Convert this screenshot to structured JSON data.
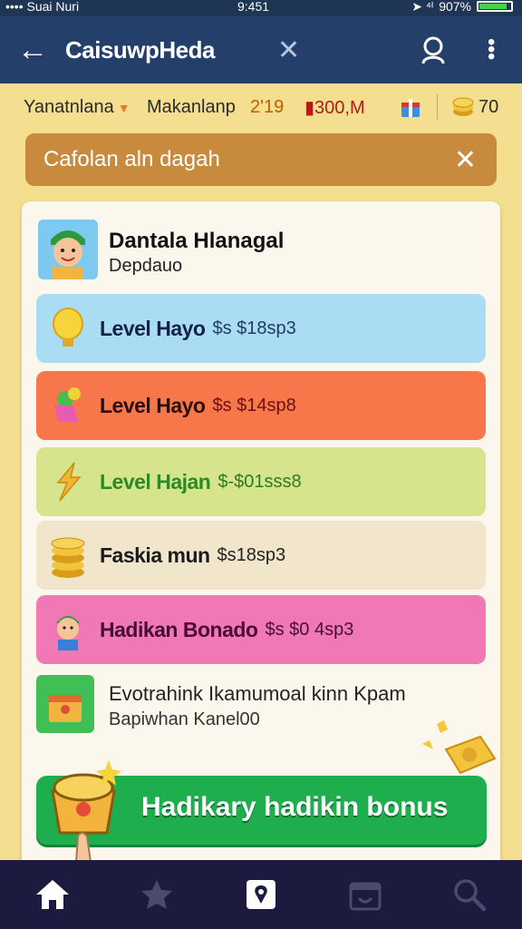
{
  "status_bar": {
    "carrier": "•••• Suai Nuri",
    "time": "9:451",
    "battery": "907%"
  },
  "app_bar": {
    "title": "CaisuwpHeda"
  },
  "info_bar": {
    "region": "Yanatnlana",
    "food": "Makanlanp",
    "num1": "2'19",
    "num2": "300,M",
    "coins": "70"
  },
  "notice": {
    "text": "Cafolan aln dagah"
  },
  "user": {
    "name": "Dantala Hlanagal",
    "sub": "Depdauo"
  },
  "rows": [
    {
      "label": "Level Hayo",
      "amount": "$s $18sp3"
    },
    {
      "label": "Level Hayo",
      "amount": "$s $14sp8"
    },
    {
      "label": "Level Hajan",
      "amount": "$-$01sss8"
    },
    {
      "label": "Faskia mun",
      "amount": "$s18sp3"
    },
    {
      "label": "Hadikan Bonado",
      "amount": "$s $0 4sp3"
    }
  ],
  "promo": {
    "line1": "Evotrahink Ikamumoal kinn Kpam",
    "line2": "Bapiwhan Kanel00"
  },
  "bonus": {
    "label": "Hadikary hadikin bonus"
  },
  "nav": [
    "home-icon",
    "star-icon",
    "map-pin-icon",
    "calendar-icon",
    "search-icon"
  ],
  "colors": {
    "app_bar": "#24406a",
    "bonus": "#1fae4d",
    "nav": "#1c1a3f"
  }
}
